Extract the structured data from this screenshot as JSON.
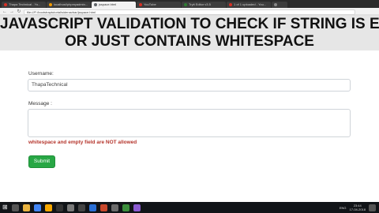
{
  "browser": {
    "tabs": [
      {
        "label": "Thapa Technical - Yo...",
        "color": "#d93025",
        "active": false
      },
      {
        "label": "localhost/phpmyadmin...",
        "color": "#f29900",
        "active": false
      },
      {
        "label": "jsspace.html",
        "color": "#5f6368",
        "active": true
      },
      {
        "label": "YouTube",
        "color": "#d93025",
        "active": false
      },
      {
        "label": "Tryit Editor v3.5",
        "color": "#2e7d32",
        "active": false
      },
      {
        "label": "1 of 1 uploaded - You...",
        "color": "#d93025",
        "active": false
      },
      {
        "label": "",
        "color": "#888888",
        "active": false
      }
    ],
    "url": "file:///F:/bootstraptutorial/sidenavbar/jsspace.html"
  },
  "banner": {
    "line1": "JAVASCRIPT VALIDATION TO CHECK IF STRING IS EMPTY",
    "line2": "OR JUST CONTAINS WHITESPACE"
  },
  "form": {
    "username_label": "Username:",
    "username_value": "ThapaTechnical",
    "message_label": "Message :",
    "message_value": "",
    "error_text": "whitespace and empty field are NOT allowed",
    "submit_label": "Submit"
  },
  "taskbar": {
    "lang": "ENG",
    "time": "23:44",
    "date": "17-04-2018"
  },
  "colors": {
    "submit": "#28a745",
    "error": "#b5352c"
  }
}
